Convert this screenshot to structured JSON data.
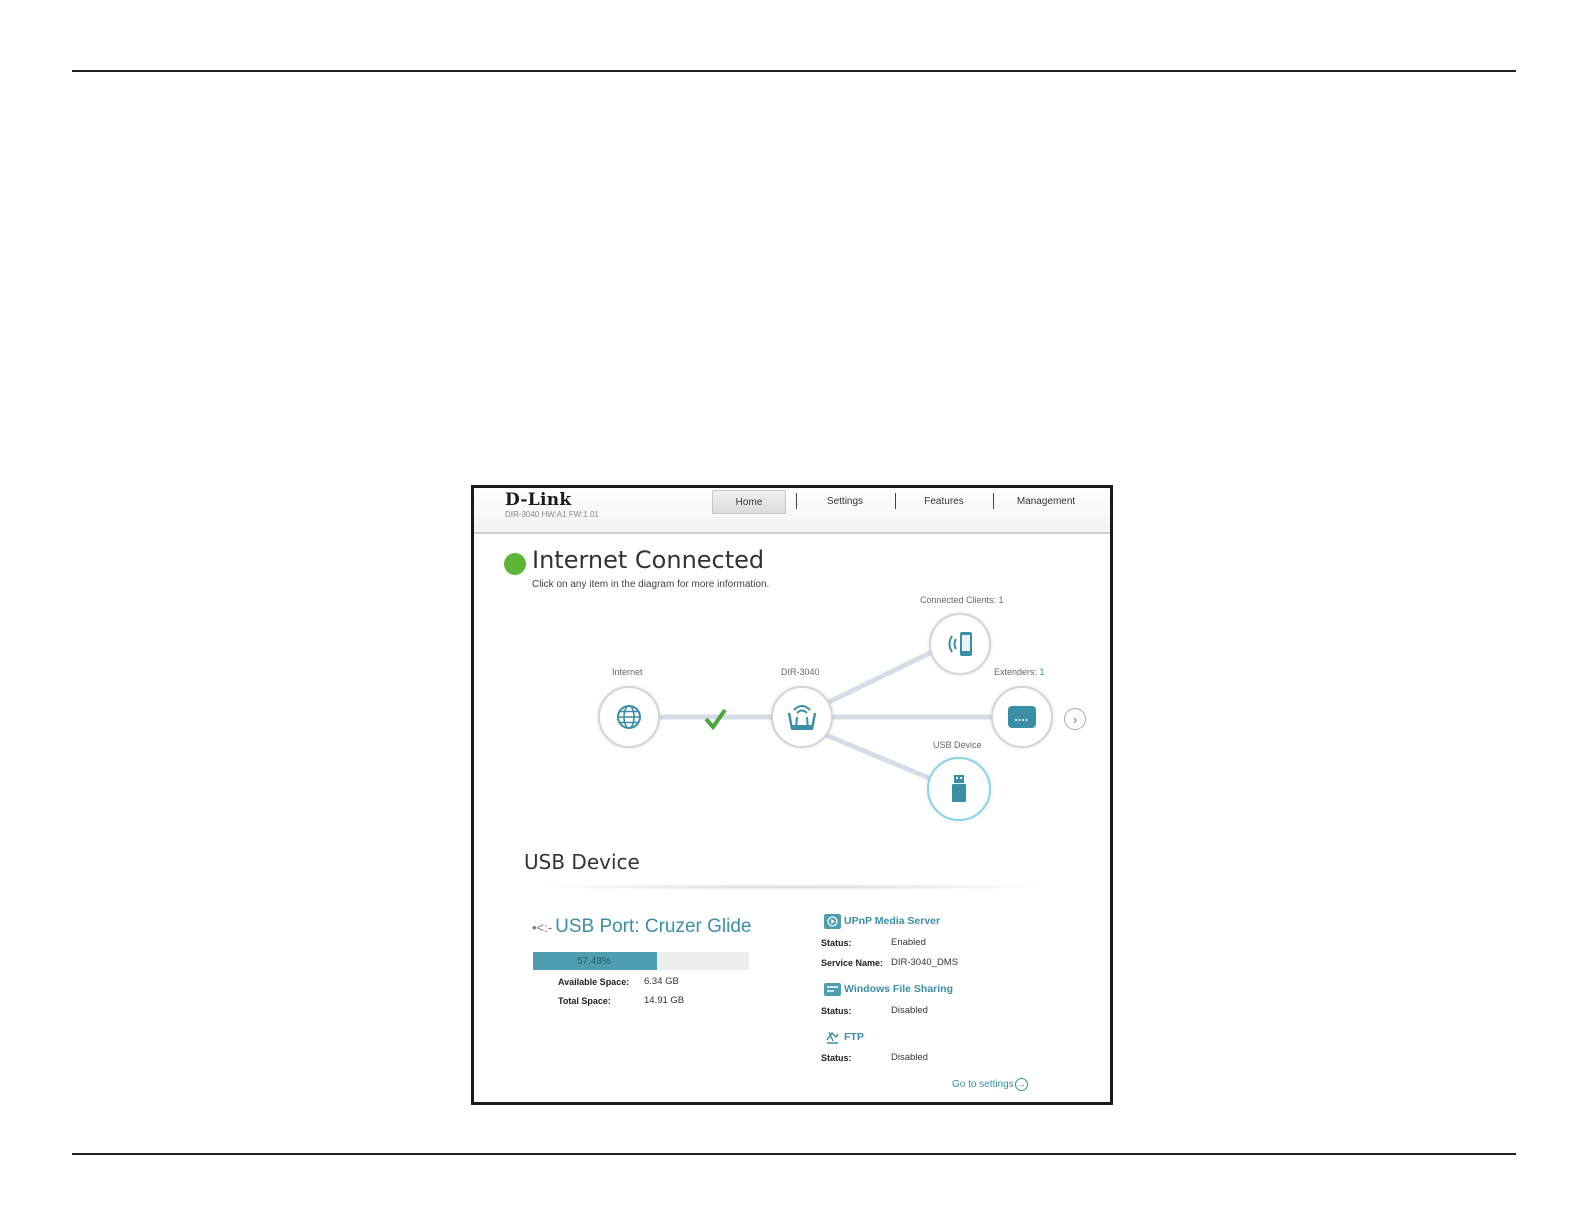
{
  "header": {
    "logo": "D-Link",
    "firmware": "DIR-3040 HW:A1 FW:1.01",
    "nav": [
      "Home",
      "Settings",
      "Features",
      "Management"
    ],
    "active_nav": "Home"
  },
  "status": {
    "title": "Internet Connected",
    "hint": "Click on any item in the diagram for more information.",
    "color": "#5db534"
  },
  "diagram": {
    "internet_label": "Internet",
    "router_label": "DIR-3040",
    "clients_label": "Connected Clients: 1",
    "extenders_label": "Extenders:",
    "extenders_count": "1",
    "usb_label": "USB Device"
  },
  "usb": {
    "section_title": "USB Device",
    "port_symbol": "•<:-",
    "port_title": "USB Port: Cruzer Glide",
    "usage_text": "57.48%",
    "usage_fraction": 0.5748,
    "available_label": "Available Space:",
    "available_value": "6.34 GB",
    "total_label": "Total Space:",
    "total_value": "14.91 GB"
  },
  "services": {
    "upnp_title": "UPnP Media Server",
    "upnp_status_label": "Status:",
    "upnp_status": "Enabled",
    "upnp_service_label": "Service Name:",
    "upnp_service_value": "DIR-3040_DMS",
    "smb_title": "Windows File Sharing",
    "smb_status_label": "Status:",
    "smb_status": "Disabled",
    "ftp_title": "FTP",
    "ftp_status_label": "Status:",
    "ftp_status": "Disabled",
    "goto": "Go to settings"
  },
  "colors": {
    "accent": "#3a8fa6",
    "bar": "#4f9db0",
    "green": "#5db534"
  }
}
